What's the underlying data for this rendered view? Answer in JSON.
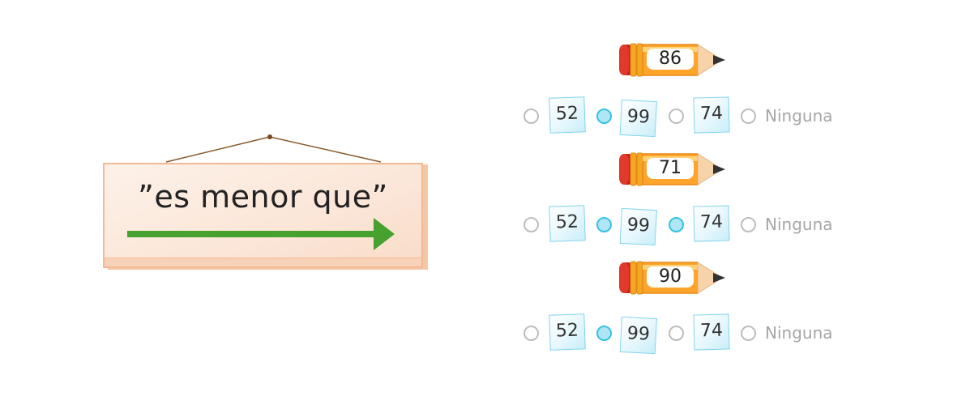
{
  "sign": {
    "text": "”es menor que”"
  },
  "colors": {
    "arrow": "#46a12e",
    "radio_selected": "#38c3e0",
    "radio_unselected": "#bdbdbd",
    "card_border": "#7fd3ee",
    "pencil_body": "#fda52a",
    "pencil_eraser": "#c6211f"
  },
  "questions": [
    {
      "pencil_value": "86",
      "options": [
        {
          "value": "52",
          "selected": false
        },
        {
          "value": "99",
          "selected": true
        },
        {
          "value": "74",
          "selected": false
        }
      ],
      "none_label": "Ninguna",
      "none_selected": false
    },
    {
      "pencil_value": "71",
      "options": [
        {
          "value": "52",
          "selected": false
        },
        {
          "value": "99",
          "selected": true
        },
        {
          "value": "74",
          "selected": true
        }
      ],
      "none_label": "Ninguna",
      "none_selected": false
    },
    {
      "pencil_value": "90",
      "options": [
        {
          "value": "52",
          "selected": false
        },
        {
          "value": "99",
          "selected": true
        },
        {
          "value": "74",
          "selected": false
        }
      ],
      "none_label": "Ninguna",
      "none_selected": false
    }
  ]
}
